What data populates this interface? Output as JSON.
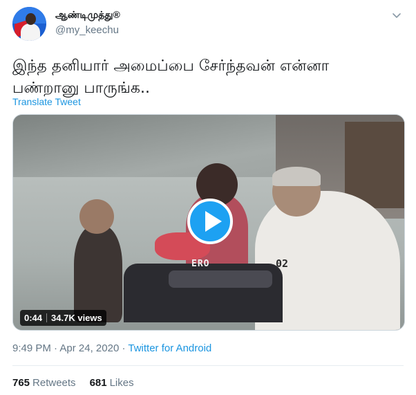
{
  "author": {
    "display_name": "ஆண்டிமுத்து®",
    "handle": "@my_keechu"
  },
  "tweet": {
    "text": "இந்த தனியார் அமைப்பை சேர்ந்தவன் என்னா பண்றானு பாருங்க..",
    "translate_label": "Translate Tweet"
  },
  "video": {
    "duration": "0:44",
    "views": "34.7K views",
    "watermark_left": "ERO",
    "watermark_right": "02"
  },
  "meta": {
    "time": "9:49 PM",
    "separator1": "·",
    "date": "Apr 24, 2020",
    "separator2": "·",
    "source": "Twitter for Android"
  },
  "stats": {
    "retweets_count": "765",
    "retweets_label": "Retweets",
    "likes_count": "681",
    "likes_label": "Likes"
  },
  "icons": {
    "menu": "chevron-down-icon",
    "play": "play-icon"
  },
  "colors": {
    "accent": "#1b95e0",
    "play_button": "#1da1f2",
    "secondary_text": "#657786"
  }
}
